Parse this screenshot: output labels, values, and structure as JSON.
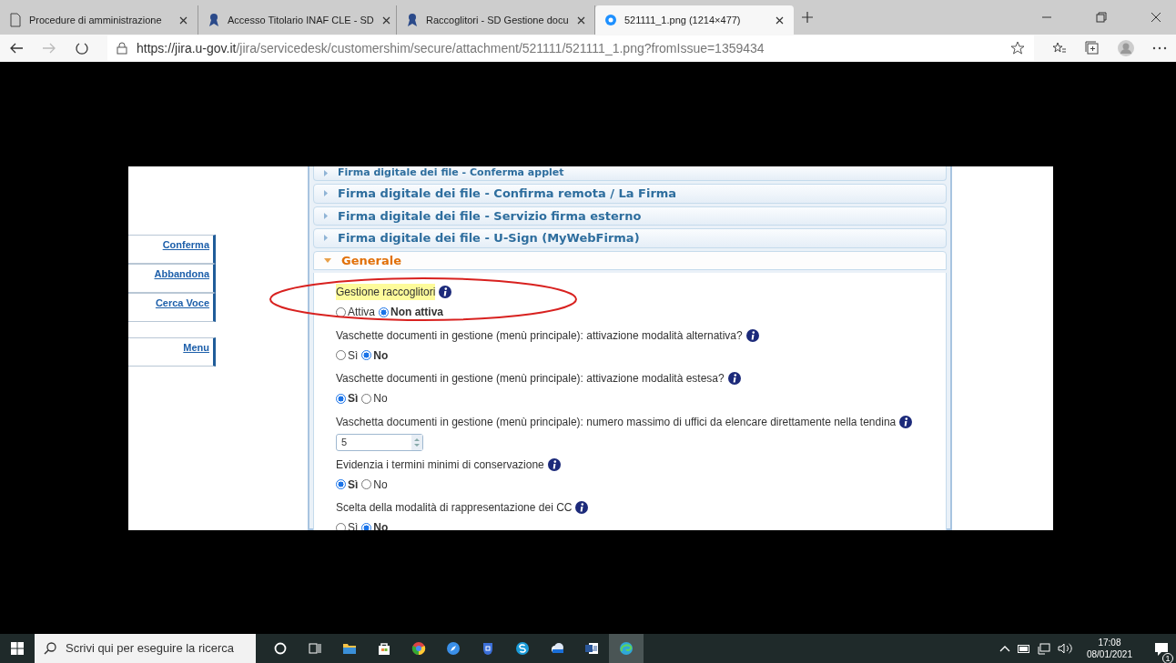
{
  "browser": {
    "tabs": [
      {
        "title": "Procedure di amministrazione",
        "selected": false
      },
      {
        "title": "Accesso Titolario INAF CLE - SD",
        "selected": false
      },
      {
        "title": "Raccoglitori - SD Gestione docu",
        "selected": false
      },
      {
        "title": "521111_1.png (1214×477)",
        "selected": true
      }
    ],
    "address": {
      "host": "https://jira.u-gov.it",
      "path": "/jira/servicedesk/customershim/secure/attachment/521111/521111_1.png?fromIssue=1359434"
    }
  },
  "sidebar": {
    "buttons": [
      {
        "label": "Conferma"
      },
      {
        "label": "Abbandona"
      },
      {
        "label": "Cerca Voce"
      },
      {
        "label": "Menu"
      }
    ]
  },
  "sections": [
    {
      "title": "Firma digitale dei file - Conferma applet",
      "expanded": false
    },
    {
      "title": "Firma digitale dei file - Confirma remota / La Firma",
      "expanded": false
    },
    {
      "title": "Firma digitale dei file - Servizio firma esterno",
      "expanded": false
    },
    {
      "title": "Firma digitale dei file - U-Sign (MyWebFirma)",
      "expanded": false
    },
    {
      "title": "Generale",
      "expanded": true,
      "settings": [
        {
          "label": "Gestione raccoglitori",
          "highlighted": true,
          "circled": true,
          "kind": "radio",
          "options": [
            {
              "label": "Attiva",
              "selected": false
            },
            {
              "label": "Non attiva",
              "selected": true
            }
          ]
        },
        {
          "label": "Vaschette documenti in gestione (menù principale): attivazione modalità alternativa?",
          "highlighted": false,
          "circled": false,
          "kind": "radio",
          "options": [
            {
              "label": "Sì",
              "selected": false
            },
            {
              "label": "No",
              "selected": true
            }
          ]
        },
        {
          "label": "Vaschette documenti in gestione (menù principale): attivazione modalità estesa?",
          "highlighted": false,
          "circled": false,
          "kind": "radio",
          "options": [
            {
              "label": "Sì",
              "selected": true
            },
            {
              "label": "No",
              "selected": false
            }
          ]
        },
        {
          "label": "Vaschetta documenti in gestione (menù principale): numero massimo di uffici da elencare direttamente nella tendina",
          "highlighted": false,
          "circled": false,
          "kind": "spinner",
          "value": "5"
        },
        {
          "label": "Evidenzia i termini minimi di conservazione",
          "highlighted": false,
          "circled": false,
          "kind": "radio",
          "options": [
            {
              "label": "Sì",
              "selected": true
            },
            {
              "label": "No",
              "selected": false
            }
          ]
        },
        {
          "label": "Scelta della modalità di rappresentazione dei CC",
          "highlighted": false,
          "circled": false,
          "kind": "radio",
          "options": [
            {
              "label": "Sì",
              "selected": false
            },
            {
              "label": "No",
              "selected": true
            }
          ]
        }
      ]
    }
  ],
  "taskbar": {
    "search_placeholder": "Scrivi qui per eseguire la ricerca",
    "time": "17:08",
    "date": "08/01/2021",
    "notifications": "1"
  }
}
